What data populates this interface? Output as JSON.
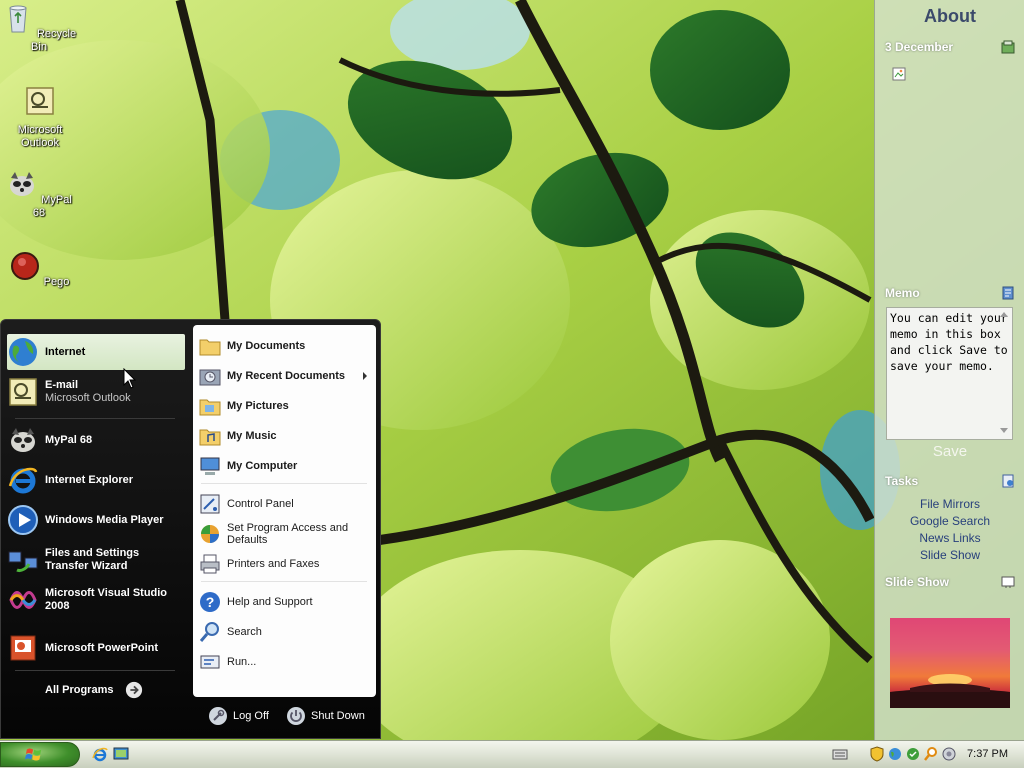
{
  "desktop": {
    "icons": [
      {
        "label": "Recycle Bin"
      },
      {
        "label": "Microsoft Outlook"
      },
      {
        "label": "MyPal 68"
      },
      {
        "label": "Pego"
      }
    ]
  },
  "start_menu": {
    "pinned": [
      {
        "title": "Internet",
        "icon": "globe-icon"
      },
      {
        "title": "E-mail",
        "subtitle": "Microsoft Outlook",
        "icon": "outlook-icon"
      }
    ],
    "recent": [
      {
        "title": "MyPal 68",
        "icon": "raccoon-icon"
      },
      {
        "title": "Internet Explorer",
        "icon": "ie-icon"
      },
      {
        "title": "Windows Media Player",
        "icon": "media-player-icon"
      },
      {
        "title": "Files and Settings Transfer Wizard",
        "icon": "transfer-wizard-icon"
      },
      {
        "title": "Microsoft Visual Studio 2008",
        "icon": "visual-studio-icon"
      },
      {
        "title": "Microsoft PowerPoint",
        "icon": "powerpoint-icon"
      }
    ],
    "all_programs": "All Programs",
    "right": [
      {
        "label": "My Documents",
        "icon": "folder-icon"
      },
      {
        "label": "My Recent Documents",
        "icon": "recent-docs-icon"
      },
      {
        "label": "My Pictures",
        "icon": "folder-pictures-icon"
      },
      {
        "label": "My Music",
        "icon": "folder-music-icon"
      },
      {
        "label": "My Computer",
        "icon": "computer-icon"
      },
      {
        "label": "Control Panel",
        "icon": "control-panel-icon"
      },
      {
        "label": "Set Program Access and Defaults",
        "icon": "program-access-icon"
      },
      {
        "label": "Printers and Faxes",
        "icon": "printer-icon"
      },
      {
        "label": "Help and Support",
        "icon": "help-icon"
      },
      {
        "label": "Search",
        "icon": "search-icon"
      },
      {
        "label": "Run...",
        "icon": "run-icon"
      }
    ],
    "log_off": "Log Off",
    "shut_down": "Shut Down"
  },
  "sidebar": {
    "about_title": "About",
    "calendar_heading": "3 December",
    "memo_heading": "Memo",
    "memo_text": "You can edit your memo in this box and click Save to save your memo.",
    "memo_save": "Save",
    "tasks_heading": "Tasks",
    "tasks": [
      "File Mirrors",
      "Google Search",
      "News Links",
      "Slide Show"
    ],
    "slideshow_heading": "Slide Show"
  },
  "taskbar": {
    "clock": "7:37 PM"
  },
  "colors": {
    "start_menu_bg": "#050505",
    "selected_item": "#d3e6c3",
    "sidebar_link": "#28407c"
  }
}
